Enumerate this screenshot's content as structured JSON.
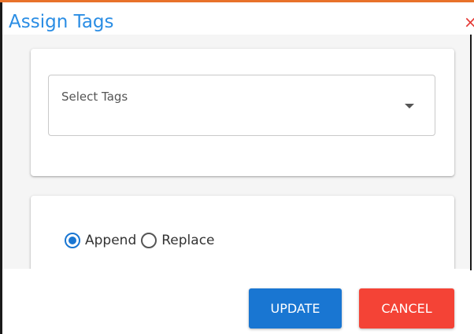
{
  "dialog": {
    "title": "Assign Tags",
    "close_icon": "close-icon",
    "close_glyph": "×"
  },
  "tags": {
    "label": "Select Tags",
    "dropdown_icon": "caret-down-icon"
  },
  "mode": {
    "options": [
      {
        "label": "Append",
        "selected": true
      },
      {
        "label": "Replace",
        "selected": false
      }
    ]
  },
  "actions": {
    "update_label": "UPDATE",
    "cancel_label": "CANCEL"
  },
  "colors": {
    "title": "#2a8de4",
    "accent_top": "#e8722a",
    "update": "#1976d2",
    "cancel": "#f44336",
    "close": "#e53935"
  }
}
